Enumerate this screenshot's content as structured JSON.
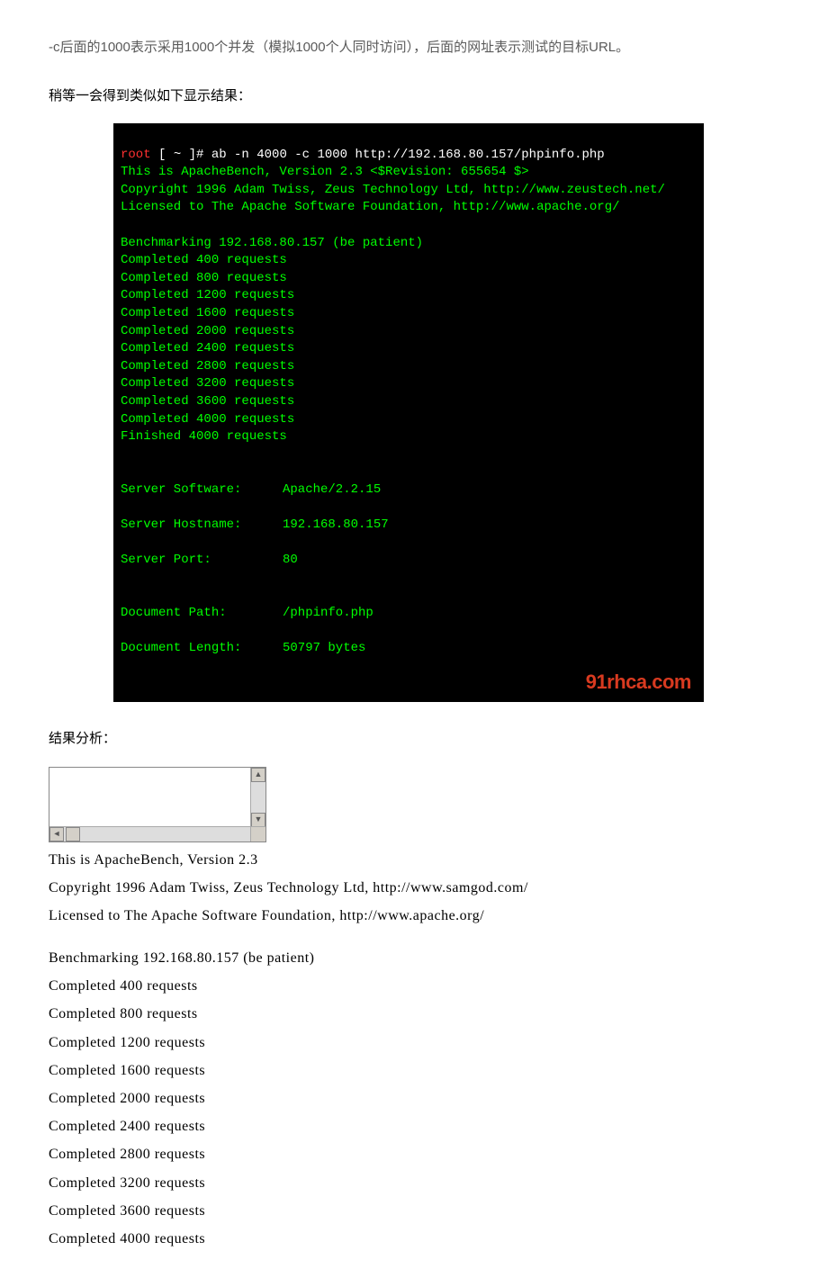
{
  "intro": {
    "p1": "-c后面的1000表示采用1000个并发（模拟1000个人同时访问），后面的网址表示测试的目标URL。",
    "p2": "稍等一会得到类似如下显示结果："
  },
  "terminal": {
    "prompt_user": "root",
    "prompt_rest": " [ ~ ]# ",
    "command": "ab -n 4000 -c 1000 http://192.168.80.157/phpinfo.php",
    "line_version": "This is ApacheBench, Version 2.3 <$Revision: 655654 $>",
    "line_copy": "Copyright 1996 Adam Twiss, Zeus Technology Ltd, http://www.zeustech.net/",
    "line_lic": "Licensed to The Apache Software Foundation, http://www.apache.org/",
    "line_bench": "Benchmarking 192.168.80.157 (be patient)",
    "progress": [
      "Completed 400 requests",
      "Completed 800 requests",
      "Completed 1200 requests",
      "Completed 1600 requests",
      "Completed 2000 requests",
      "Completed 2400 requests",
      "Completed 2800 requests",
      "Completed 3200 requests",
      "Completed 3600 requests",
      "Completed 4000 requests",
      "Finished 4000 requests"
    ],
    "kv": [
      {
        "k": "Server Software:",
        "v": "Apache/2.2.15"
      },
      {
        "k": "Server Hostname:",
        "v": "192.168.80.157"
      },
      {
        "k": "Server Port:",
        "v": "80"
      }
    ],
    "kv2": [
      {
        "k": "Document Path:",
        "v": "/phpinfo.php"
      },
      {
        "k": "Document Length:",
        "v": "50797 bytes"
      }
    ],
    "watermark": "91rhca.com"
  },
  "analysis_title": "结果分析：",
  "body": {
    "l1": "This  is  ApacheBench,  Version  2.3",
    "l2": "Copyright  1996  Adam  Twiss,  Zeus  Technology  Ltd,  http://www.samgod.com/",
    "l3": "Licensed  to  The  Apache  Software  Foundation,  http://www.apache.org/",
    "l4": "Benchmarking  192.168.80.157  (be  patient)",
    "progress": [
      "Completed  400  requests",
      "Completed  800  requests",
      "Completed  1200  requests",
      "Completed  1600  requests",
      "Completed  2000  requests",
      "Completed  2400  requests",
      "Completed  2800  requests",
      "Completed  3200  requests",
      "Completed  3600  requests",
      "Completed  4000  requests"
    ]
  }
}
